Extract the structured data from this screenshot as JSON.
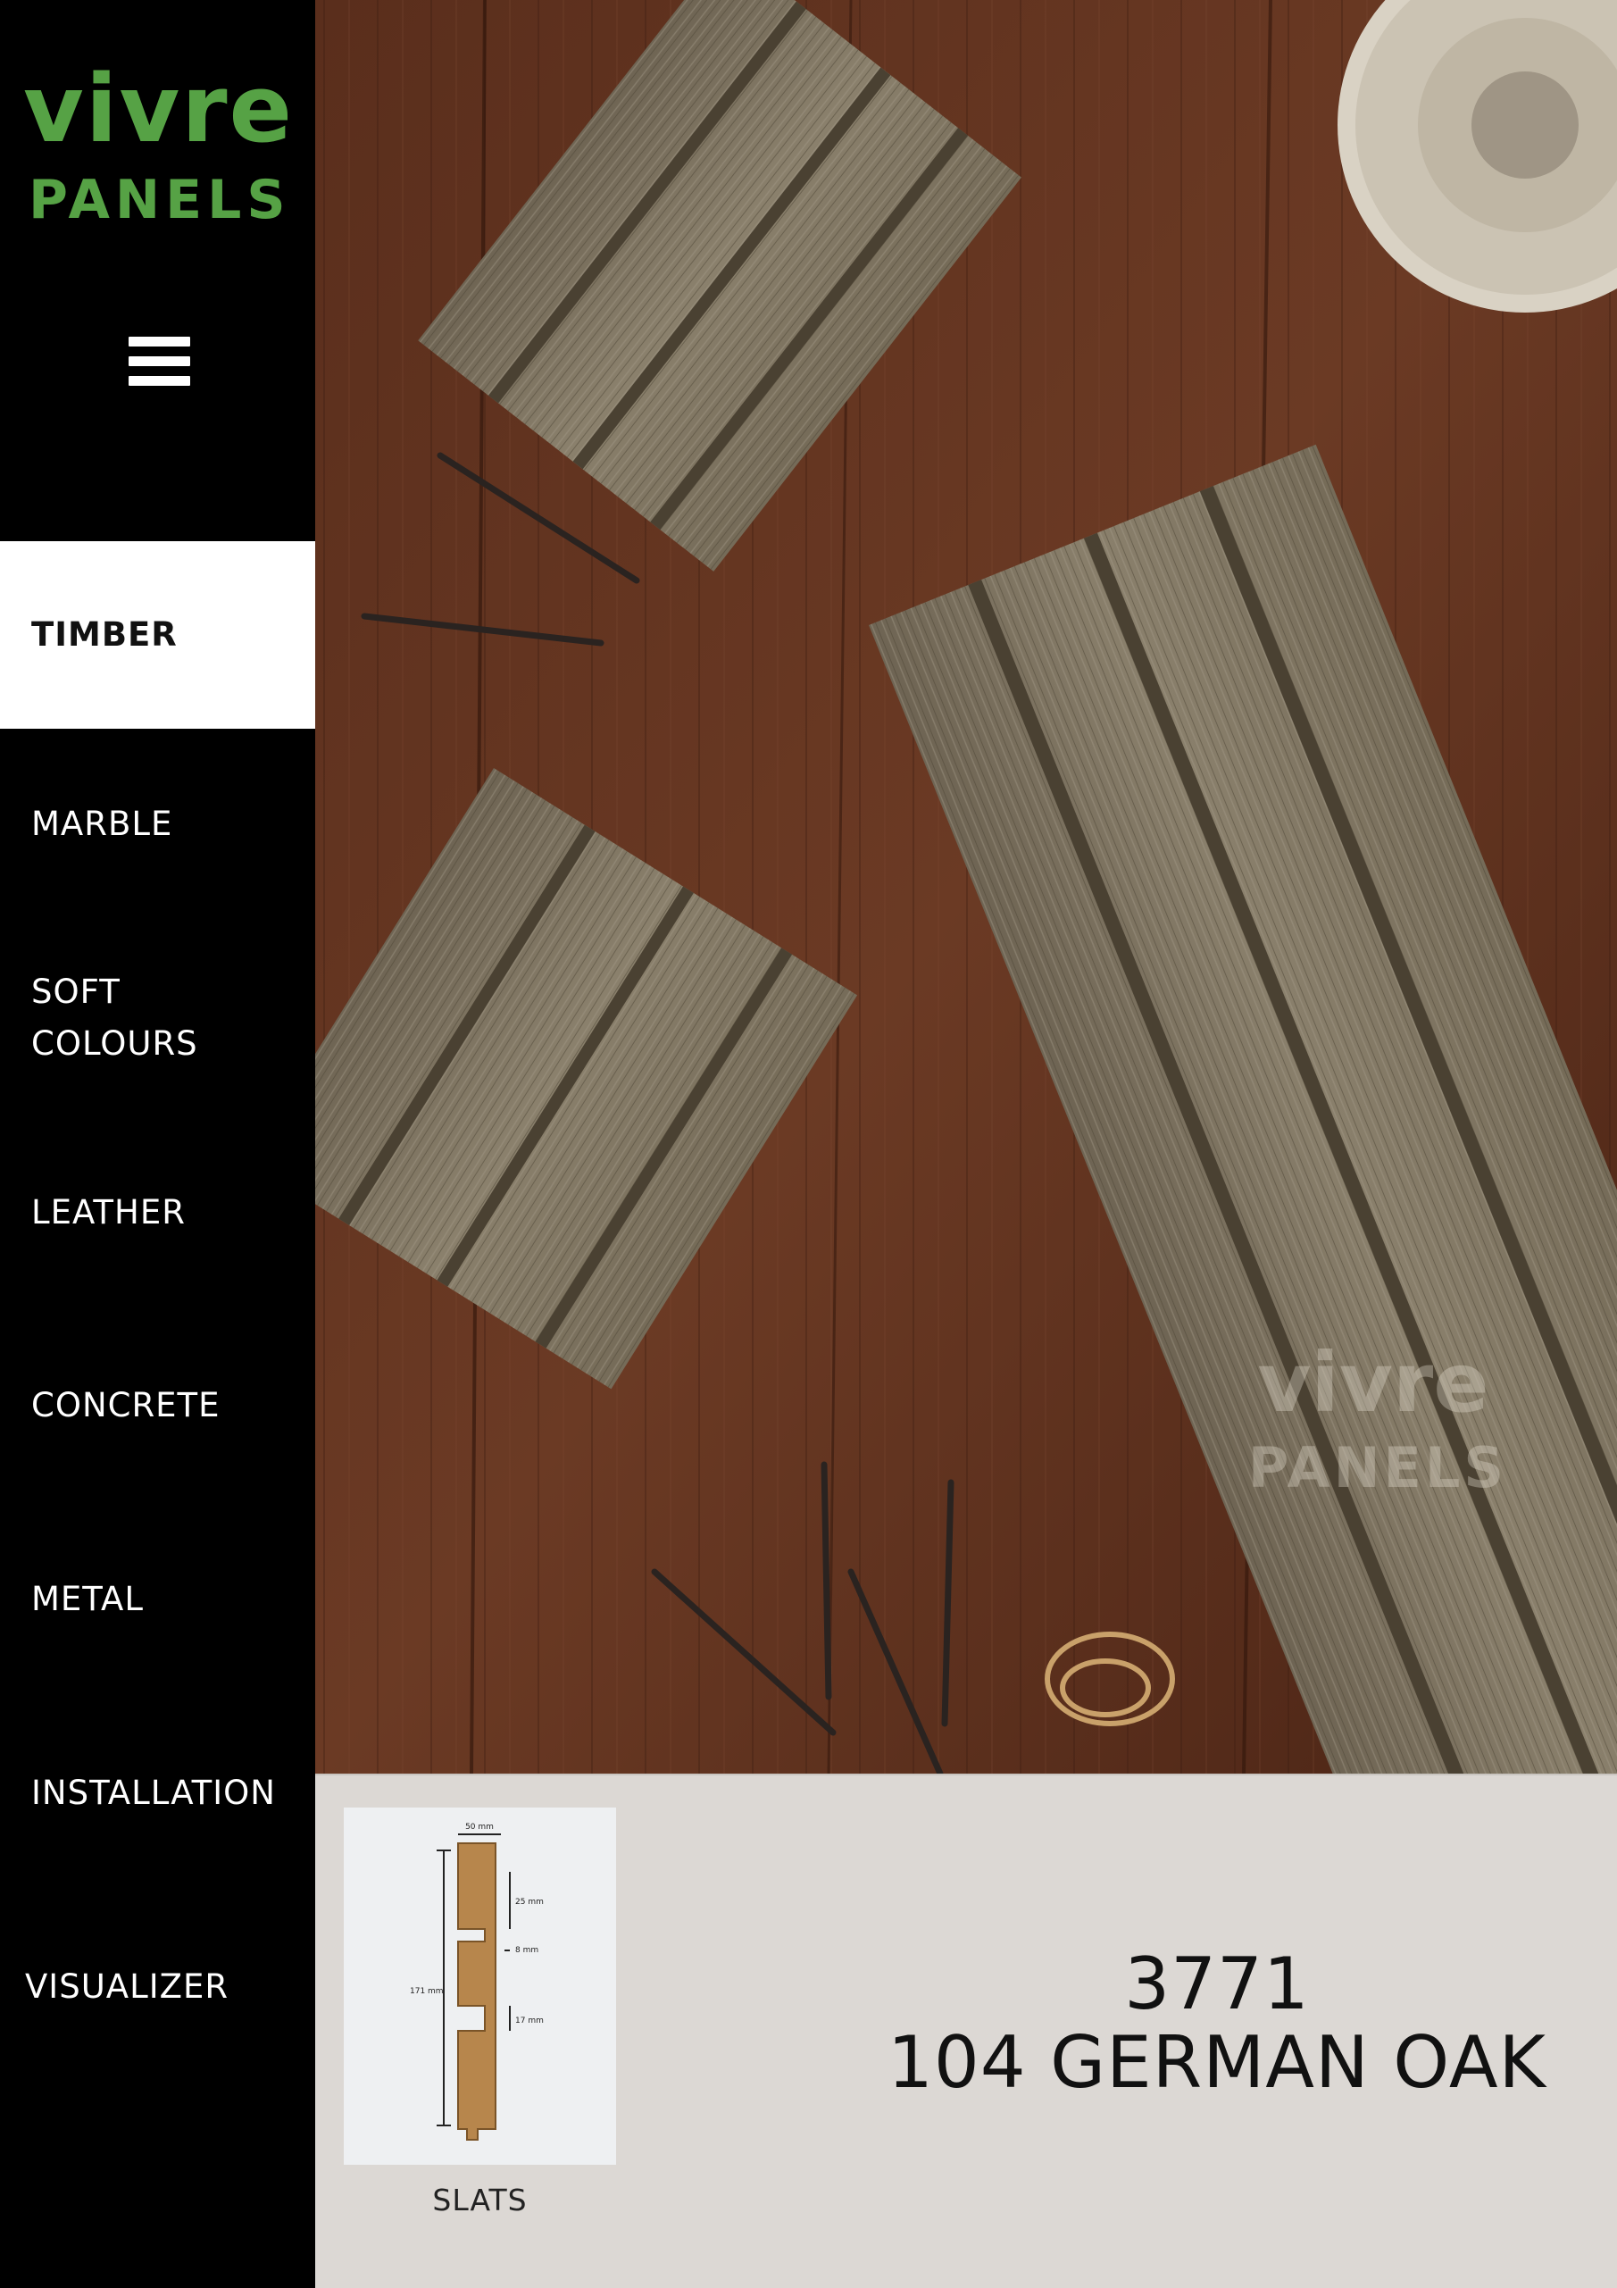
{
  "brand": {
    "name_line1": "vivre",
    "name_line2": "PANELS",
    "color": "#56a245"
  },
  "menu_icon": "hamburger-icon",
  "nav": {
    "items": [
      {
        "label": "TIMBER",
        "active": true
      },
      {
        "label": "MARBLE"
      },
      {
        "label": "SOFT\nCOLOURS"
      },
      {
        "label": "LEATHER"
      },
      {
        "label": "CONCRETE"
      },
      {
        "label": "METAL"
      },
      {
        "label": "INSTALLATION"
      },
      {
        "label": "VISUALIZER"
      }
    ]
  },
  "hero": {
    "watermark_line1": "vivre",
    "watermark_line2": "PANELS"
  },
  "product": {
    "code": "3771",
    "name": "104 GERMAN OAK",
    "profile_caption": "SLATS",
    "profile_dimensions": {
      "width": "50 mm",
      "groove_spacing": "25 mm",
      "groove_depth": "8 mm",
      "groove_width": "17 mm",
      "height": "171 mm"
    }
  }
}
